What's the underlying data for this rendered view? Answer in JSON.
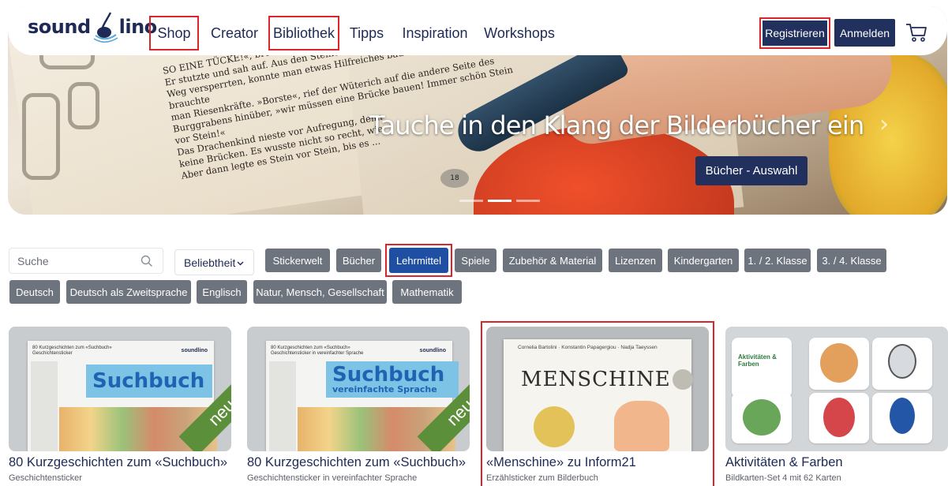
{
  "brand": {
    "logo_left": "sound",
    "logo_right": "lino",
    "colors": {
      "navy": "#22305e",
      "chip_gray": "#6d747e",
      "chip_active": "#1f4fa3",
      "highlight_red": "#d9252b"
    }
  },
  "nav": {
    "items": [
      {
        "label": "Shop",
        "highlighted": true
      },
      {
        "label": "Creator",
        "highlighted": false
      },
      {
        "label": "Bibliothek",
        "highlighted": true
      },
      {
        "label": "Tipps",
        "highlighted": false
      },
      {
        "label": "Inspiration",
        "highlighted": false
      },
      {
        "label": "Workshops",
        "highlighted": false
      }
    ],
    "register_label": "Registrieren",
    "login_label": "Anmelden",
    "cart_icon": "cart-icon"
  },
  "hero": {
    "title": "Tauche in den Klang der Bilderbücher ein",
    "cta_label": "Bücher - Auswahl",
    "next_icon": "chevron-right-icon",
    "slides_total": 3,
    "slide_active": 2,
    "page_number": "18",
    "book_text": [
      "SO EINE TÜCKE!«, brüllte der Wüterich. »Da hilft nur eine ...«",
      "Er stutzte und sah auf. Aus den Steinen, die ihnen den",
      "Weg versperrten, konnte man etwas Hilfreiches bauen! Nur, dafür brauchte",
      "man Riesenkräfte. »Borste«, rief der Wüterich auf die andere Seite des",
      "Burggrabens hinüber, »wir müssen eine Brücke bauen! Immer schön Stein",
      "vor Stein!«",
      "Das Drachenkind nieste vor Aufregung, denn",
      "keine Brücken. Es wusste nicht so recht, wie",
      "Aber dann legte es Stein vor Stein, bis es ..."
    ]
  },
  "filters": {
    "search_placeholder": "Suche",
    "sort_label": "Beliebtheit",
    "chips_row1": [
      "Stickerwelt",
      "Bücher",
      "Lehrmittel",
      "Spiele",
      "Zubehör & Material",
      "Lizenzen",
      "Kindergarten",
      "1. / 2. Klasse",
      "3. / 4. Klasse"
    ],
    "chips_row2": [
      "Deutsch",
      "Deutsch als Zweitsprache",
      "Englisch",
      "Natur, Mensch, Gesellschaft",
      "Mathematik"
    ],
    "active_chip": "Lehrmittel"
  },
  "products": [
    {
      "title": "80 Kurzgeschichten zum «Suchbuch»",
      "subtitle": "Geschichtensticker",
      "sheet_head": [
        "80 Kurzgeschichten zum «Suchbuch»",
        "Geschichtensticker"
      ],
      "sheet_brand": "soundlino",
      "banner_main": "Suchbuch",
      "banner_sub": "",
      "badge": "neu"
    },
    {
      "title": "80 Kurzgeschichten zum «Suchbuch»",
      "subtitle": "Geschichtensticker in vereinfachter Sprache",
      "sheet_head": [
        "80 Kurzgeschichten zum «Suchbuch»",
        "Geschichtensticker in vereinfachter Sprache"
      ],
      "sheet_brand": "soundlino",
      "banner_main": "Suchbuch",
      "banner_sub": "vereinfachte Sprache",
      "badge": "neu"
    },
    {
      "title": "«Menschine» zu Inform21",
      "subtitle": "Erzählsticker zum Bilderbuch",
      "book_authors": "Cornelia Bartolini · Konstantin Papagergiou · Nadja Taeyssen",
      "book_title": "MENSCHINE",
      "highlighted": true
    },
    {
      "title": "Aktivitäten & Farben",
      "subtitle": "Bildkarten-Set 4 mit 62 Karten",
      "box_title": "Aktivitäten & Farben"
    }
  ]
}
